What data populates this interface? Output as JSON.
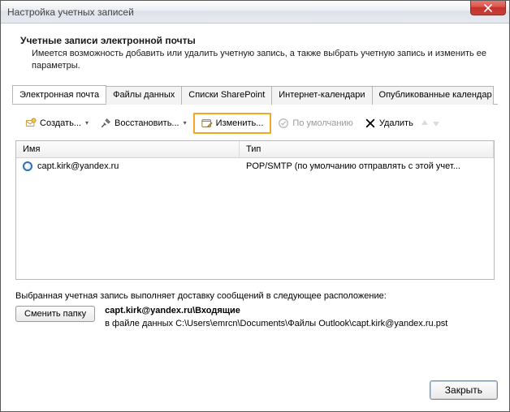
{
  "window": {
    "title": "Настройка учетных записей"
  },
  "header": {
    "title": "Учетные записи электронной почты",
    "subtitle": "Имеется возможность добавить или удалить учетную запись, а также выбрать учетную запись и изменить ее параметры."
  },
  "tabs": {
    "email": "Электронная почта",
    "datafiles": "Файлы данных",
    "sharepoint": "Списки SharePoint",
    "ical": "Интернет-календари",
    "published": "Опубликованные календар"
  },
  "toolbar": {
    "create": "Создать...",
    "restore": "Восстановить...",
    "edit": "Изменить...",
    "default": "По умолчанию",
    "delete": "Удалить"
  },
  "columns": {
    "name": "Имя",
    "type": "Тип"
  },
  "rows": [
    {
      "name": "capt.kirk@yandex.ru",
      "type": "POP/SMTP (по умолчанию отправлять с этой учет..."
    }
  ],
  "delivery": {
    "msg": "Выбранная учетная запись выполняет доставку сообщений в следующее расположение:",
    "change_folder": "Сменить папку",
    "folder_bold": "capt.kirk@yandex.ru\\Входящие",
    "path": "в файле данных C:\\Users\\emrcn\\Documents\\Файлы Outlook\\capt.kirk@yandex.ru.pst"
  },
  "footer": {
    "close": "Закрыть"
  }
}
